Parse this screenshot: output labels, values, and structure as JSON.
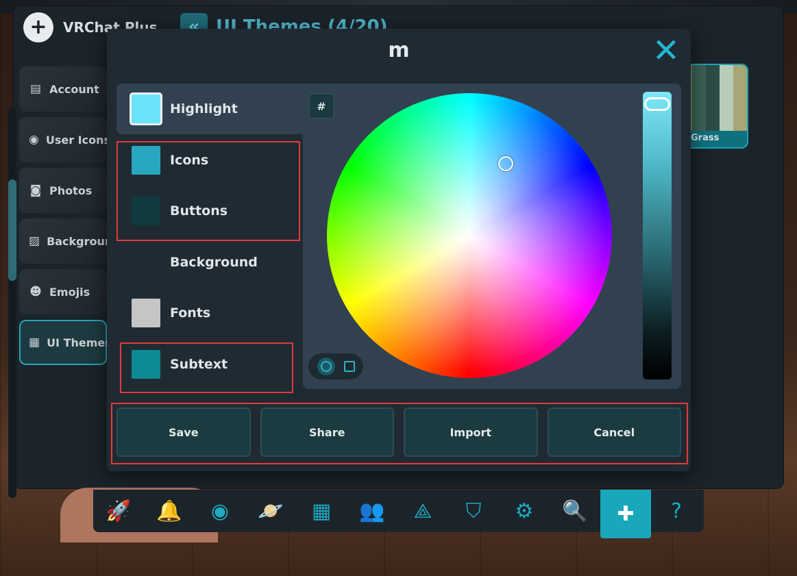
{
  "background_app": {
    "title": "VRChat Plus",
    "section_title": "UI Themes (4/20)",
    "sidebar": [
      {
        "label": "Account",
        "icon": "document-icon"
      },
      {
        "label": "User Icons",
        "icon": "user-circle-icon"
      },
      {
        "label": "Photos",
        "icon": "camera-icon"
      },
      {
        "label": "Backgrounds",
        "icon": "image-icon"
      },
      {
        "label": "Emojis",
        "icon": "emoji-icon"
      },
      {
        "label": "UI Themes",
        "icon": "theme-grid-icon"
      }
    ],
    "theme_card": {
      "label": "Grass",
      "swatch_colors": [
        "#6f8a5f",
        "#3d6356",
        "#2d4c47",
        "#b7ccb8",
        "#a8a676"
      ]
    }
  },
  "modal": {
    "title": "m",
    "close_icon": "✕",
    "color_items": [
      {
        "label": "Highlight",
        "color": "#6be3f9"
      },
      {
        "label": "Icons",
        "color": "#27a8bf"
      },
      {
        "label": "Buttons",
        "color": "#0f3a3e"
      },
      {
        "label": "Background",
        "color": ""
      },
      {
        "label": "Fonts",
        "color": "#c5c5c5"
      },
      {
        "label": "Subtext",
        "color": "#0e8a93"
      }
    ],
    "hex_button": "#",
    "buttons": {
      "save": "Save",
      "share": "Share",
      "import": "Import",
      "cancel": "Cancel"
    }
  },
  "dock": [
    {
      "icon": "rocket-icon",
      "glyph": "🚀"
    },
    {
      "icon": "bell-icon",
      "glyph": "🔔"
    },
    {
      "icon": "profile-icon",
      "glyph": "◉"
    },
    {
      "icon": "worlds-icon",
      "glyph": "🪐"
    },
    {
      "icon": "avatars-icon",
      "glyph": "▦"
    },
    {
      "icon": "social-icon",
      "glyph": "👥"
    },
    {
      "icon": "groups-icon",
      "glyph": "⟁"
    },
    {
      "icon": "safety-shield-icon",
      "glyph": "⛉"
    },
    {
      "icon": "settings-gear-icon",
      "glyph": "⚙"
    },
    {
      "icon": "search-icon",
      "glyph": "🔍"
    },
    {
      "icon": "vrchat-plus-icon",
      "glyph": "✚"
    },
    {
      "icon": "help-icon",
      "glyph": "?"
    }
  ],
  "colors": {
    "accent": "#23b7cf",
    "highlight_box": "#e23b3b"
  }
}
